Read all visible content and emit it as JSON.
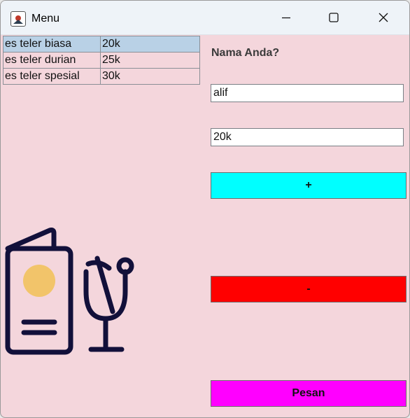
{
  "window": {
    "title": "Menu",
    "controls": [
      "minimize-icon",
      "maximize-icon",
      "close-icon"
    ]
  },
  "menu_table": {
    "rows": [
      {
        "item": "es teler biasa",
        "price": "20k",
        "selected": true
      },
      {
        "item": "es teler durian",
        "price": "25k",
        "selected": false
      },
      {
        "item": "es teler spesial",
        "price": "30k",
        "selected": false
      }
    ]
  },
  "form": {
    "name_label": "Nama Anda?",
    "name_value": "alif",
    "price_value": "20k",
    "plus_label": "+",
    "minus_label": "-",
    "order_label": "Pesan"
  },
  "colors": {
    "background": "#f4d6dc",
    "plus_button": "#00ffff",
    "minus_button": "#ff0000",
    "order_button": "#ff00ff",
    "selected_row": "#b9d1e6",
    "illustration_stroke": "#12103a",
    "illustration_circle": "#f2c46a"
  },
  "illustration": {
    "icons": [
      "menu-card-icon",
      "drink-glass-icon"
    ]
  }
}
